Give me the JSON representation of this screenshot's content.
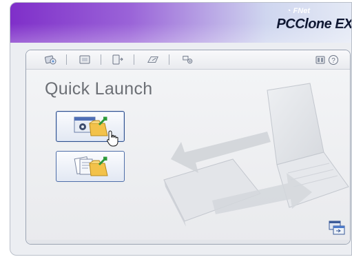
{
  "window": {
    "brand_small": "FNet",
    "brand_name": "PCClone EX"
  },
  "toolbar": {
    "icons": [
      "quick-launch-icon",
      "backup-icon",
      "transfer-icon",
      "restore-icon",
      "settings-icon"
    ],
    "help_icons": [
      "about-icon",
      "help-icon"
    ]
  },
  "main": {
    "title": "Quick Launch",
    "buttons": [
      {
        "name": "quick-backup-button",
        "icon": "backup-folder-icon"
      },
      {
        "name": "quick-copy-button",
        "icon": "documents-folder-icon"
      }
    ]
  },
  "colors": {
    "title_gradient_start": "#7f2fc9",
    "title_gradient_end": "#e4e9f5",
    "button_border": "#4d6da8"
  }
}
